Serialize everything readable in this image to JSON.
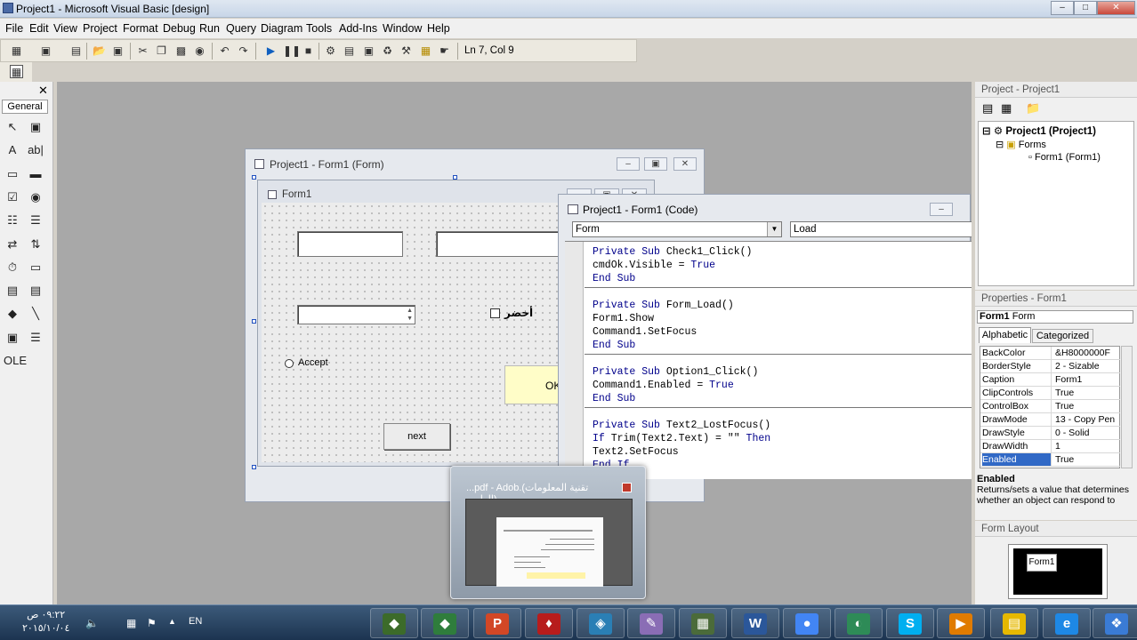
{
  "window": {
    "title": "Project1 - Microsoft Visual Basic [design]",
    "min": "–",
    "max": "□",
    "close": "✕"
  },
  "menu": [
    "File",
    "Edit",
    "View",
    "Project",
    "Format",
    "Debug",
    "Run",
    "Query",
    "Diagram",
    "Tools",
    "Add-Ins",
    "Window",
    "Help"
  ],
  "toolbar": {
    "status": "Ln 7, Col 9",
    "icons": [
      "add-project-icon",
      "add-form-icon",
      "menu-editor-icon",
      "open-icon",
      "save-icon",
      "cut-icon",
      "copy-icon",
      "paste-icon",
      "find-icon",
      "undo-icon",
      "redo-icon",
      "start-icon",
      "break-icon",
      "end-icon",
      "project-explorer-icon",
      "properties-window-icon",
      "form-layout-icon",
      "object-browser-icon",
      "toolbox-icon",
      "data-view-icon",
      "component-manager-icon"
    ]
  },
  "toolbox": {
    "close": "✕",
    "tab": "General",
    "tools": [
      "pointer-tool-icon",
      "picturebox-tool-icon",
      "label-tool-icon",
      "textbox-tool-icon",
      "frame-tool-icon",
      "commandbutton-tool-icon",
      "checkbox-tool-icon",
      "optionbutton-tool-icon",
      "combobox-tool-icon",
      "listbox-tool-icon",
      "hscrollbar-tool-icon",
      "vscrollbar-tool-icon",
      "timer-tool-icon",
      "drivelistbox-tool-icon",
      "dirlistbox-tool-icon",
      "filelistbox-tool-icon",
      "shape-tool-icon",
      "line-tool-icon",
      "image-tool-icon",
      "data-tool-icon",
      "ole-tool-icon"
    ],
    "tool_glyphs": [
      "↖",
      "▣",
      "A",
      "ab|",
      "▭",
      "▬",
      "☑",
      "◉",
      "☷",
      "☰",
      "⇄",
      "⇅",
      "⏱",
      "▭",
      "▤",
      "▤",
      "◆",
      "╲",
      "▣",
      "☰",
      "OLE"
    ]
  },
  "designer": {
    "title": "Project1 - Form1 (Form)",
    "form_caption": "Form1",
    "checkbox_label": "أخضر",
    "option_label": "Accept",
    "ok_label": "OK",
    "next_label": "next"
  },
  "code_window": {
    "title": "Project1 - Form1 (Code)",
    "object_combo": "Form",
    "proc_combo": "Load",
    "procedures": [
      [
        "Private Sub Check1_Click()",
        "cmdOk.Visible = True",
        "End Sub"
      ],
      [
        "Private Sub Form_Load()",
        "Form1.Show",
        "Command1.SetFocus",
        "End Sub"
      ],
      [
        "Private Sub Option1_Click()",
        "Command1.Enabled = True",
        "End Sub"
      ],
      [
        "Private Sub Text2_LostFocus()",
        "If Trim(Text2.Text) = \"\" Then",
        "Text2.SetFocus",
        "End If"
      ]
    ]
  },
  "thumbnail": {
    "title": "...pdf - Adob.(تقنية المعلومات (العلمي"
  },
  "project_pane": {
    "title": "Project - Project1",
    "root": "Project1 (Project1)",
    "folder": "Forms",
    "item": "Form1 (Form1)"
  },
  "properties_pane": {
    "title": "Properties - Form1",
    "object": "Form1",
    "object_type": "Form",
    "tabs": [
      "Alphabetic",
      "Categorized"
    ],
    "rows": [
      {
        "name": "BackColor",
        "value": "&H8000000F"
      },
      {
        "name": "BorderStyle",
        "value": "2 - Sizable"
      },
      {
        "name": "Caption",
        "value": "Form1"
      },
      {
        "name": "ClipControls",
        "value": "True"
      },
      {
        "name": "ControlBox",
        "value": "True"
      },
      {
        "name": "DrawMode",
        "value": "13 - Copy Pen"
      },
      {
        "name": "DrawStyle",
        "value": "0 - Solid"
      },
      {
        "name": "DrawWidth",
        "value": "1"
      },
      {
        "name": "Enabled",
        "value": "True"
      }
    ],
    "desc_title": "Enabled",
    "desc_text": "Returns/sets a value that determines whether an object can respond to"
  },
  "layout_pane": {
    "title": "Form Layout",
    "form_label": "Form1"
  },
  "taskbar": {
    "time": "٠٩:٢٢ ص",
    "date": "٢٠١٥/١٠/٠٤",
    "lang": "EN",
    "apps": [
      "cmd-icon",
      "cmd2-icon",
      "powerpoint-icon",
      "acrobat-icon",
      "app-icon",
      "paint-icon",
      "calc-icon",
      "word-icon",
      "chrome-icon",
      "internet-icon",
      "skype-icon",
      "media-icon",
      "explorer-icon",
      "ie-icon",
      "windows-icon"
    ],
    "app_glyphs": [
      "◆",
      "◆",
      "P",
      "♦",
      "◈",
      "✎",
      "▦",
      "W",
      "●",
      "◐",
      "S",
      "▶",
      "▤",
      "e",
      "❖"
    ],
    "app_colors": [
      "#3c6b2a",
      "#2f7d3c",
      "#d24726",
      "#b71c1c",
      "#2a7fb5",
      "#8a6db5",
      "#4b6b3a",
      "#2b579a",
      "#4285f4",
      "#2e8b57",
      "#00aff0",
      "#e07b00",
      "#e6b800",
      "#1e88e5",
      "#3a7bd5"
    ]
  }
}
